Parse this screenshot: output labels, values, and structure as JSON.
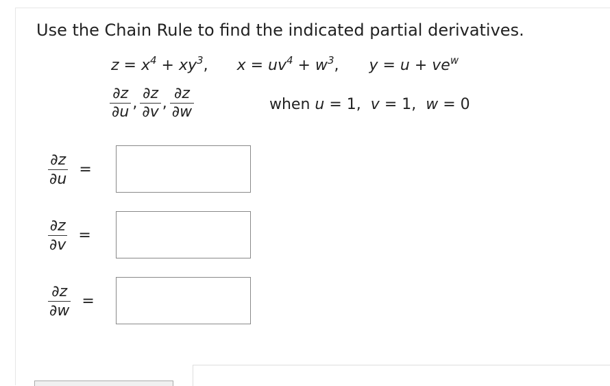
{
  "instruction": "Use the Chain Rule to find the indicated partial derivatives.",
  "equations": {
    "z_def": "z = x",
    "z_exp1": "4",
    "z_mid": " + xy",
    "z_exp2": "3",
    "z_end": ",",
    "x_def": "x = uv",
    "x_exp1": "4",
    "x_mid": " + w",
    "x_exp2": "3",
    "x_end": ",",
    "y_def": "y = u + ve",
    "y_exp": "w"
  },
  "derivatives_list": [
    {
      "num": "∂z",
      "den": "∂u"
    },
    {
      "num": "∂z",
      "den": "∂v"
    },
    {
      "num": "∂z",
      "den": "∂w"
    }
  ],
  "condition": {
    "when": "when",
    "u": "u",
    "u_val": " = 1,",
    "v": "v",
    "v_val": " = 1,",
    "w": "w",
    "w_val": " = 0"
  },
  "answers": [
    {
      "num": "∂z",
      "den": "∂u",
      "equals": "=",
      "value": ""
    },
    {
      "num": "∂z",
      "den": "∂v",
      "equals": "=",
      "value": ""
    },
    {
      "num": "∂z",
      "den": "∂w",
      "equals": "=",
      "value": ""
    }
  ]
}
